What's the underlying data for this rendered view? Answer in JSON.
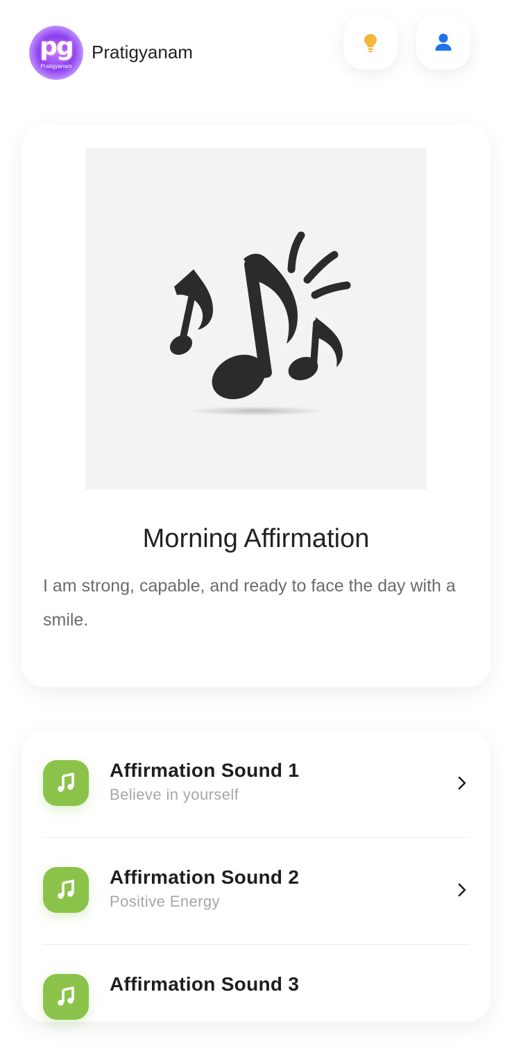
{
  "header": {
    "logo_text": "pg",
    "logo_subtext": "Pratigyanam",
    "app_name": "Pratigyanam",
    "buttons": [
      {
        "icon": "lightbulb-icon",
        "color": "#f4b73b"
      },
      {
        "icon": "user-icon",
        "color": "#1e73e8"
      }
    ]
  },
  "featured": {
    "image_icon": "music-notes-icon",
    "title": "Morning Affirmation",
    "description": "I am strong, capable, and ready to face the day with a smile."
  },
  "sounds": [
    {
      "title": "Affirmation Sound 1",
      "subtitle": "Believe in yourself",
      "icon": "music-note-icon"
    },
    {
      "title": "Affirmation Sound 2",
      "subtitle": "Positive Energy",
      "icon": "music-note-icon"
    },
    {
      "title": "Affirmation Sound 3",
      "subtitle": "",
      "icon": "music-note-icon"
    }
  ],
  "colors": {
    "accent_green": "#8bc34a",
    "logo_purple": "#8a3ff0",
    "text_dark": "#222222",
    "text_muted": "#6b6b6b"
  }
}
